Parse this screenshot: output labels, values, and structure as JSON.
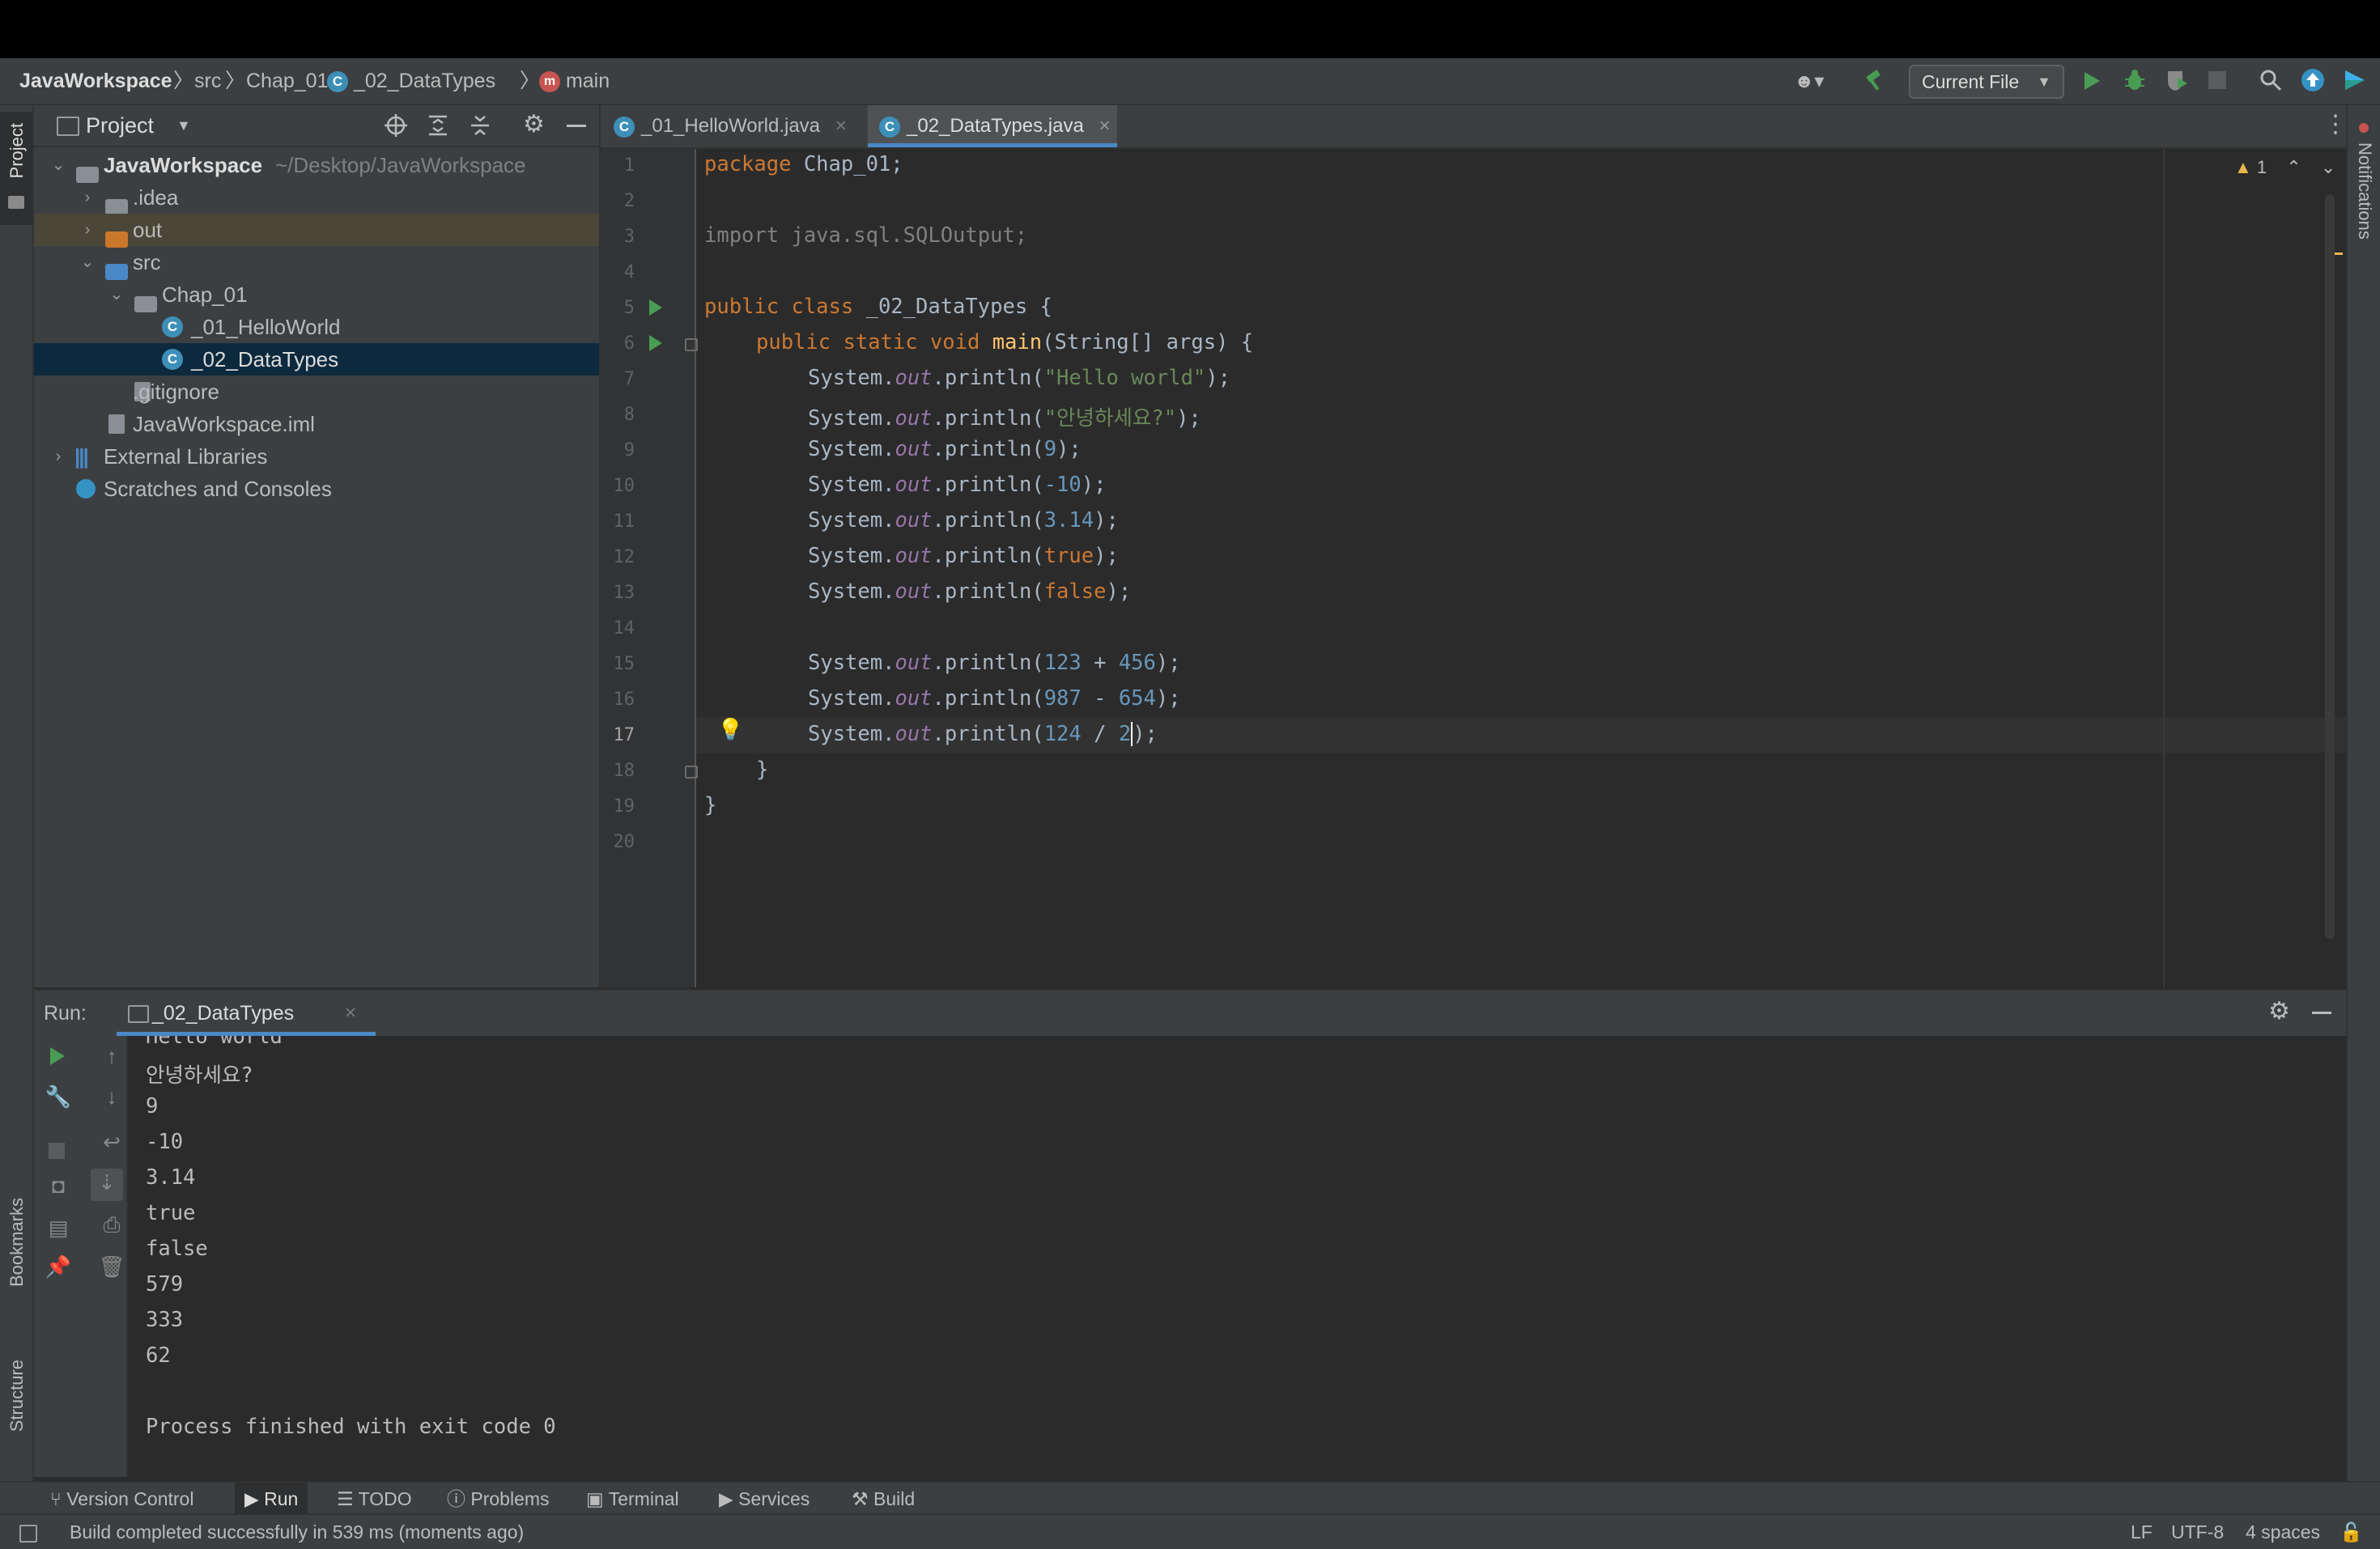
{
  "breadcrumb": {
    "project": "JavaWorkspace",
    "src": "src",
    "package": "Chap_01",
    "class": "_02_DataTypes",
    "method": "main"
  },
  "toolbar": {
    "run_config": "Current File"
  },
  "project_panel": {
    "title": "Project",
    "tree": [
      {
        "label": "JavaWorkspace",
        "path": "~/Desktop/JavaWorkspace"
      },
      {
        "label": ".idea"
      },
      {
        "label": "out"
      },
      {
        "label": "src"
      },
      {
        "label": "Chap_01"
      },
      {
        "label": "_01_HelloWorld"
      },
      {
        "label": "_02_DataTypes"
      },
      {
        "label": ".gitignore"
      },
      {
        "label": "JavaWorkspace.iml"
      },
      {
        "label": "External Libraries"
      },
      {
        "label": "Scratches and Consoles"
      }
    ]
  },
  "editor": {
    "tabs": [
      {
        "label": "_01_HelloWorld.java"
      },
      {
        "label": "_02_DataTypes.java"
      }
    ],
    "warning_count": "1",
    "line_numbers": [
      "1",
      "2",
      "3",
      "4",
      "5",
      "6",
      "7",
      "8",
      "9",
      "10",
      "11",
      "12",
      "13",
      "14",
      "15",
      "16",
      "17",
      "18",
      "19",
      "20"
    ],
    "code": {
      "l1_kw": "package",
      "l1_rest": " Chap_01;",
      "l3": "import java.sql.SQLOutput;",
      "l5_kw": "public class",
      "l5_rest": " _02_DataTypes {",
      "l6_kw": "public static void",
      "l6_fn": "main",
      "l6_rest": "(String[] args) {",
      "sys": "System.",
      "out": "out",
      "println": ".println(",
      "close": ");",
      "l7_arg": "\"Hello world\"",
      "l8_arg": "\"안녕하세요?\"",
      "l9_arg": "9",
      "l10_arg": "-10",
      "l11_arg": "3.14",
      "l12_arg": "true",
      "l13_arg": "false",
      "l15_a": "123",
      "l15_op": " + ",
      "l15_b": "456",
      "l16_a": "987",
      "l16_op": " - ",
      "l16_b": "654",
      "l17_a": "124",
      "l17_op": " / ",
      "l17_b": "2",
      "l18": "}",
      "l19": "}"
    }
  },
  "run_panel": {
    "label": "Run:",
    "tab": "_02_DataTypes",
    "output": [
      "Hello world",
      "안녕하세요?",
      "9",
      "-10",
      "3.14",
      "true",
      "false",
      "579",
      "333",
      "62"
    ],
    "exit_message": "Process finished with exit code 0"
  },
  "left_strip": {
    "project": "Project",
    "bookmarks": "Bookmarks",
    "structure": "Structure"
  },
  "right_strip": {
    "notifications": "Notifications"
  },
  "bottom_tools": {
    "version_control": "Version Control",
    "run": "Run",
    "todo": "TODO",
    "problems": "Problems",
    "terminal": "Terminal",
    "services": "Services",
    "build": "Build"
  },
  "status": {
    "message": "Build completed successfully in 539 ms (moments ago)",
    "line_sep": "LF",
    "encoding": "UTF-8",
    "indent": "4 spaces"
  },
  "colors": {
    "background": "#2b2b2b",
    "panel": "#3c3f41",
    "selection": "#0d293e",
    "accent": "#4a88c7",
    "run_green": "#499c54"
  }
}
